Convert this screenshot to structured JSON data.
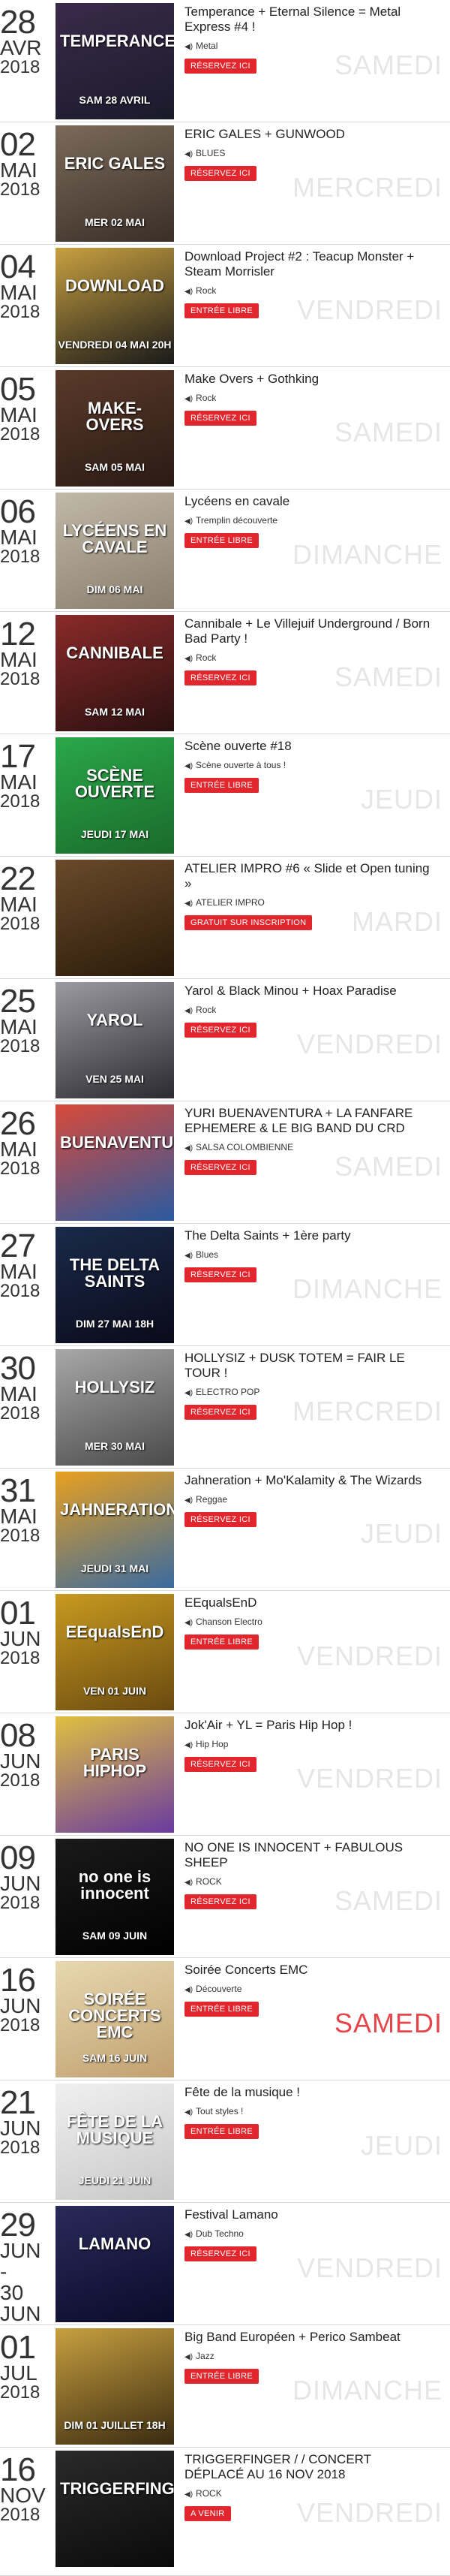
{
  "events": [
    {
      "day": "28",
      "month": "AVR",
      "year": "2018",
      "title": "Temperance + Eternal Silence = Metal Express #4 !",
      "genre": "Metal",
      "cta": "RÉSERVEZ ICI",
      "weekday": "SAMEDI",
      "poster_title": "TEMPERANCE",
      "poster_date": "SAM 28 AVRIL",
      "bg": "#3a2a4a",
      "bg2": "#1a1a2a"
    },
    {
      "day": "02",
      "month": "MAI",
      "year": "2018",
      "title": "ERIC GALES + GUNWOOD",
      "genre": "BLUES",
      "cta": "RÉSERVEZ ICI",
      "weekday": "MERCREDI",
      "poster_title": "ERIC GALES",
      "poster_date": "MER 02 MAI",
      "bg": "#7a6a5a",
      "bg2": "#3a2e26"
    },
    {
      "day": "04",
      "month": "MAI",
      "year": "2018",
      "title": "Download Project #2 : Teacup Monster + Steam Morrisler",
      "genre": "Rock",
      "cta": "ENTRÉE LIBRE",
      "weekday": "VENDREDI",
      "poster_title": "DOWNLOAD",
      "poster_date": "VENDREDI 04 MAI 20H",
      "bg": "#c8a040",
      "bg2": "#1a1a1a"
    },
    {
      "day": "05",
      "month": "MAI",
      "year": "2018",
      "title": "Make Overs + Gothking",
      "genre": "Rock",
      "cta": "RÉSERVEZ ICI",
      "weekday": "SAMEDI",
      "poster_title": "MAKE-OVERS",
      "poster_date": "SAM 05 MAI",
      "bg": "#5a3a2a",
      "bg2": "#2a1a14"
    },
    {
      "day": "06",
      "month": "MAI",
      "year": "2018",
      "title": "Lycéens en cavale",
      "genre": "Tremplin découverte",
      "cta": "ENTRÉE LIBRE",
      "weekday": "DIMANCHE",
      "poster_title": "LYCÉENS EN CAVALE",
      "poster_date": "DIM 06 MAI",
      "bg": "#c0b8a8",
      "bg2": "#8a7e6e"
    },
    {
      "day": "12",
      "month": "MAI",
      "year": "2018",
      "title": "Cannibale + Le Villejuif Underground / Born Bad Party !",
      "genre": "Rock",
      "cta": "RÉSERVEZ ICI",
      "weekday": "SAMEDI",
      "poster_title": "CANNIBALE",
      "poster_date": "SAM 12 MAI",
      "bg": "#8a2a2a",
      "bg2": "#2a1010"
    },
    {
      "day": "17",
      "month": "MAI",
      "year": "2018",
      "title": "Scène ouverte #18",
      "genre": "Scène ouverte à tous !",
      "cta": "ENTRÉE LIBRE",
      "weekday": "JEUDI",
      "poster_title": "SCÈNE OUVERTE",
      "poster_date": "JEUDI 17 MAI",
      "bg": "#2aa84a",
      "bg2": "#1a6a2a"
    },
    {
      "day": "22",
      "month": "MAI",
      "year": "2018",
      "title": "ATELIER IMPRO #6 « Slide et Open tuning »",
      "genre": "ATELIER IMPRO",
      "cta": "GRATUIT SUR INSCRIPTION",
      "weekday": "MARDI",
      "poster_title": "",
      "poster_date": "",
      "bg": "#6a4a2a",
      "bg2": "#2a1a0a"
    },
    {
      "day": "25",
      "month": "MAI",
      "year": "2018",
      "title": "Yarol & Black Minou + Hoax Paradise",
      "genre": "Rock",
      "cta": "RÉSERVEZ ICI",
      "weekday": "VENDREDI",
      "poster_title": "YAROL",
      "poster_date": "VEN 25 MAI",
      "bg": "#9a9aa0",
      "bg2": "#2a2a30"
    },
    {
      "day": "26",
      "month": "MAI",
      "year": "2018",
      "title": "YURI BUENAVENTURA + LA FANFARE EPHEMERE & LE BIG BAND DU CRD",
      "genre": "SALSA COLOMBIENNE",
      "cta": "RÉSERVEZ ICI",
      "weekday": "SAMEDI",
      "poster_title": "BUENAVENTURA",
      "poster_date": "",
      "bg": "#d84a3a",
      "bg2": "#2a5aa0"
    },
    {
      "day": "27",
      "month": "MAI",
      "year": "2018",
      "title": "The Delta Saints + 1ère party",
      "genre": "Blues",
      "cta": "RÉSERVEZ ICI",
      "weekday": "DIMANCHE",
      "poster_title": "THE DELTA SAINTS",
      "poster_date": "DIM 27 MAI 18H",
      "bg": "#1a2a4a",
      "bg2": "#0a0a1a"
    },
    {
      "day": "30",
      "month": "MAI",
      "year": "2018",
      "title": "HOLLYSIZ + DUSK TOTEM = FAIR LE TOUR !",
      "genre": "ELECTRO POP",
      "cta": "RÉSERVEZ ICI",
      "weekday": "MERCREDI",
      "poster_title": "HOLLYSIZ",
      "poster_date": "MER 30 MAI",
      "bg": "#a8a8a8",
      "bg2": "#4a4a4a"
    },
    {
      "day": "31",
      "month": "MAI",
      "year": "2018",
      "title": "Jahneration + Mo'Kalamity & The Wizards",
      "genre": "Reggae",
      "cta": "RÉSERVEZ ICI",
      "weekday": "JEUDI",
      "poster_title": "JAHNERATION",
      "poster_date": "JEUDI 31 MAI",
      "bg": "#e8a020",
      "bg2": "#3a6aa0"
    },
    {
      "day": "01",
      "month": "JUN",
      "year": "2018",
      "title": "EEqualsEnD",
      "genre": "Chanson Electro",
      "cta": "ENTRÉE LIBRE",
      "weekday": "VENDREDI",
      "poster_title": "EEqualsEnD",
      "poster_date": "VEN 01 JUIN",
      "bg": "#c89a20",
      "bg2": "#6a4a10"
    },
    {
      "day": "08",
      "month": "JUN",
      "year": "2018",
      "title": "Jok'Air + YL = Paris Hip Hop !",
      "genre": "Hip Hop",
      "cta": "RÉSERVEZ ICI",
      "weekday": "VENDREDI",
      "poster_title": "PARIS HIPHOP",
      "poster_date": "",
      "bg": "#e0c040",
      "bg2": "#6a3aa0"
    },
    {
      "day": "09",
      "month": "JUN",
      "year": "2018",
      "title": "NO ONE IS INNOCENT + FABULOUS SHEEP",
      "genre": "ROCK",
      "cta": "RÉSERVEZ ICI",
      "weekday": "SAMEDI",
      "poster_title": "no one is innocent",
      "poster_date": "SAM 09 JUIN",
      "bg": "#1a1a1a",
      "bg2": "#000000"
    },
    {
      "day": "16",
      "month": "JUN",
      "year": "2018",
      "title": "Soirée Concerts EMC",
      "genre": "Découverte",
      "cta": "ENTRÉE LIBRE",
      "weekday": "SAMEDI",
      "weekday_highlight": true,
      "poster_title": "SOIRÉE CONCERTS EMC",
      "poster_date": "SAM 16 JUIN",
      "bg": "#e8d8b0",
      "bg2": "#c0a070"
    },
    {
      "day": "21",
      "month": "JUN",
      "year": "2018",
      "title": "Fête de la musique !",
      "genre": "Tout styles !",
      "cta": "ENTRÉE LIBRE",
      "weekday": "JEUDI",
      "poster_title": "FÊTE DE LA MUSIQUE",
      "poster_date": "JEUDI 21 JUIN",
      "bg": "#f0f0f0",
      "bg2": "#c8c8c8"
    },
    {
      "day": "29",
      "month": "JUN",
      "year": "",
      "range_end": "30",
      "month2": "JUN",
      "title": "Festival Lamano",
      "genre": "Dub Techno",
      "cta": "RÉSERVEZ ICI",
      "weekday": "VENDREDI",
      "poster_title": "LAMANO",
      "poster_date": "",
      "bg": "#2a2a5a",
      "bg2": "#0a0a2a"
    },
    {
      "day": "01",
      "month": "JUL",
      "year": "2018",
      "title": "Big Band Européen + Perico Sambeat",
      "genre": "Jazz",
      "cta": "ENTRÉE LIBRE",
      "weekday": "DIMANCHE",
      "poster_title": "",
      "poster_date": "DIM 01 JUILLET 18H",
      "bg": "#c8a040",
      "bg2": "#3a2a10"
    },
    {
      "day": "16",
      "month": "NOV",
      "year": "2018",
      "title": "TRIGGERFINGER / / CONCERT DÉPLACÉ AU 16 NOV 2018",
      "genre": "ROCK",
      "cta": "A VENIR",
      "weekday": "VENDREDI",
      "poster_title": "TRIGGERFINGER",
      "poster_date": "",
      "bg": "#2a2a2a",
      "bg2": "#0a0a0a"
    }
  ]
}
